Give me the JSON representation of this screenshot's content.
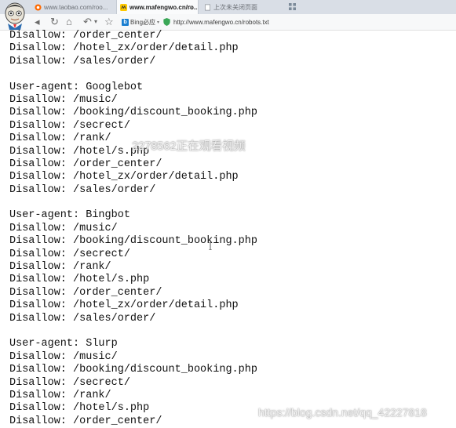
{
  "browser": {
    "tabs": [
      {
        "title": "www.taobao.com/roo...",
        "icon": "taobao-icon",
        "active": false
      },
      {
        "title": "www.mafengwo.cn/ro...",
        "icon": "mafengwo-icon",
        "active": true
      },
      {
        "title": "上次未关闭页面",
        "icon": "page-icon",
        "active": false
      }
    ],
    "search_engine_label": "Bing必应",
    "url": "http://www.mafengwo.cn/robots.txt"
  },
  "robots_lines": [
    "Disallow: /order_center/",
    "Disallow: /hotel_zx/order/detail.php",
    "Disallow: /sales/order/",
    "",
    "User-agent: Googlebot",
    "Disallow: /music/",
    "Disallow: /booking/discount_booking.php",
    "Disallow: /secrect/",
    "Disallow: /rank/",
    "Disallow: /hotel/s.php",
    "Disallow: /order_center/",
    "Disallow: /hotel_zx/order/detail.php",
    "Disallow: /sales/order/",
    "",
    "User-agent: Bingbot",
    "Disallow: /music/",
    "Disallow: /booking/discount_booking.php",
    "Disallow: /secrect/",
    "Disallow: /rank/",
    "Disallow: /hotel/s.php",
    "Disallow: /order_center/",
    "Disallow: /hotel_zx/order/detail.php",
    "Disallow: /sales/order/",
    "",
    "User-agent: Slurp",
    "Disallow: /music/",
    "Disallow: /booking/discount_booking.php",
    "Disallow: /secrect/",
    "Disallow: /rank/",
    "Disallow: /hotel/s.php",
    "Disallow: /order_center/"
  ],
  "overlays": {
    "viewer_notice": "2278562正在观看视频",
    "watermark": "https://blog.csdn.net/qq_42227818"
  }
}
